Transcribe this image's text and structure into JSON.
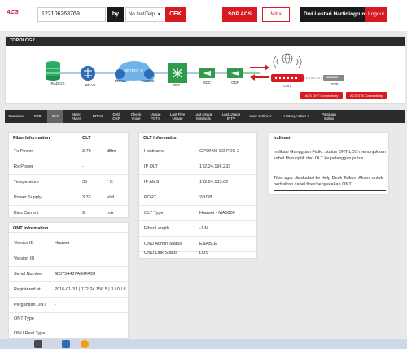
{
  "header": {
    "logo": "ACS",
    "search_value": "122106263769",
    "by_label": "by",
    "select_value": "No Inet/Telp",
    "cek_label": "CEK",
    "sop_label": "SOP ACS",
    "other_label": "Mitra",
    "user_name": "Dwi Lestari Hartiningrum",
    "logout_label": "Logout"
  },
  "topology": {
    "title": "TOPOLOGY",
    "nodes": {
      "radius": "RADIUS",
      "bras": "BRAS",
      "bras2": "BRAS",
      "metro": "METRO - E",
      "akses": "AKSES",
      "olt": "OLT",
      "odc": "ODC",
      "odp": "ODP",
      "ont": "ONT",
      "stb": "STB"
    },
    "acs_ont_btn": "ACS ONT Connectivity",
    "acs_stb_btn": "ACS STB Connectivity"
  },
  "tabs": [
    {
      "l1": "Customer",
      "l2": ""
    },
    {
      "l1": "STB",
      "l2": ""
    },
    {
      "l1": "OLT",
      "l2": ""
    },
    {
      "l1": "Metro",
      "l2": "Akses"
    },
    {
      "l1": "BRAS",
      "l2": ""
    },
    {
      "l1": "Detil",
      "l2": "OSP"
    },
    {
      "l1": "Check",
      "l2": "Voice"
    },
    {
      "l1": "Usage",
      "l2": "POTS"
    },
    {
      "l1": "Last Five",
      "l2": "Usage"
    },
    {
      "l1": "Last Usage",
      "l2": "Minitools"
    },
    {
      "l1": "Last Usage",
      "l2": "IPTV"
    },
    {
      "l1": "User Online",
      "l2": ""
    },
    {
      "l1": "History Action",
      "l2": ""
    },
    {
      "l1": "Panduan",
      "l2": "Solusi"
    }
  ],
  "fiber": {
    "title": "Fiber Information",
    "col2": "OLT",
    "rows": [
      {
        "label": "Tx Power",
        "value": "3.79",
        "unit": "dBm"
      },
      {
        "label": "Rx Power",
        "value": "-",
        "unit": ""
      },
      {
        "label": "Temperature",
        "value": "38",
        "unit": "° C"
      },
      {
        "label": "Power Supply",
        "value": "3.33",
        "unit": "Volt"
      },
      {
        "label": "Bias Current",
        "value": "9",
        "unit": "mA"
      }
    ]
  },
  "olt": {
    "title": "OLT Information",
    "rows": [
      {
        "label": "Hostname",
        "value": "GPON06-D2-PDK-2"
      },
      {
        "label": "IP OLT",
        "value": "172.24.196.233"
      },
      {
        "label": "IP AMS",
        "value": "172.24.133.62"
      },
      {
        "label": "PORT",
        "value": "2/10/8"
      },
      {
        "label": "OLT Type",
        "value": "Huawei - MA5800"
      },
      {
        "label": "Fiber Length",
        "value": "-1 M"
      },
      {
        "label": "ONU Admin Status",
        "value": "ENABLE"
      },
      {
        "label": "ONU Link Status",
        "value": "LOS"
      }
    ]
  },
  "indikasi": {
    "title": "Indikasi",
    "text1": "Indikasi Gangguan Fisik : status ONT LOS menunjukkan kabel fiber optik dari OLT ke pelanggan putus",
    "text2": "Tiket agar dieskalasi ke Help Desk Telkom Akses untuk perbaikan kabel fiber/pengecekan ONT"
  },
  "ont": {
    "title": "ONT Information",
    "rows": [
      {
        "label": "Vendor ID",
        "value": "Huawei"
      },
      {
        "label": "Version ID",
        "value": ""
      },
      {
        "label": "Serial Number",
        "value": "485754437A00FA28"
      },
      {
        "label": "Registered at",
        "value": "2016-01-31 | 172.24.156.5 | 3 / 0 / 8"
      },
      {
        "label": "Pergantian ONT",
        "value": "-"
      },
      {
        "label": "ONT Type",
        "value": ""
      },
      {
        "label": "ONU Real Type",
        "value": ""
      }
    ]
  },
  "colors": {
    "brand_red": "#d71920",
    "dark": "#2b2b2b",
    "green": "#27ae60",
    "blue": "#2d6cb5"
  }
}
